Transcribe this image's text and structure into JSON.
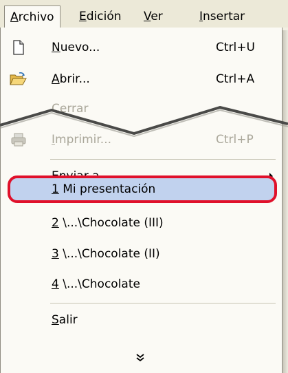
{
  "menubar": {
    "items": [
      {
        "label": "Archivo",
        "accel": "A",
        "rest": "rchivo"
      },
      {
        "label": "Edición",
        "accel": "E",
        "rest": "dición"
      },
      {
        "label": "Ver",
        "accel": "V",
        "rest": "er"
      },
      {
        "label": "Insertar",
        "accel": "I",
        "rest": "nsertar"
      }
    ]
  },
  "menu": {
    "nuevo": {
      "label": "Nuevo...",
      "accel": "N",
      "rest": "uevo...",
      "shortcut": "Ctrl+U"
    },
    "abrir": {
      "label": "Abrir...",
      "accel": "A",
      "rest": "brir...",
      "shortcut": "Ctrl+A"
    },
    "cerrar": {
      "label": "Cerrar",
      "pre": "C",
      "accel": "e",
      "rest": "rrar"
    },
    "imprimir": {
      "label": "Imprimir...",
      "accel": "I",
      "rest": "mprimir...",
      "shortcut": "Ctrl+P"
    },
    "enviar": {
      "label": "Enviar a",
      "pre": "En",
      "accel": "v",
      "rest": "iar a"
    },
    "recent": [
      {
        "label": "1 Mi presentación",
        "accel": "1",
        "rest": " Mi presentación"
      },
      {
        "label": "2 \\...\\Chocolate (III)",
        "accel": "2",
        "rest": " \\...\\Chocolate (III)"
      },
      {
        "label": "3 \\...\\Chocolate (II)",
        "accel": "3",
        "rest": " \\...\\Chocolate (II)"
      },
      {
        "label": "4 \\...\\Chocolate",
        "accel": "4",
        "rest": " \\...\\Chocolate"
      }
    ],
    "salir": {
      "label": "Salir",
      "accel": "S",
      "rest": "alir"
    }
  },
  "colors": {
    "highlight_fill": "#c1d2ee",
    "highlight_border": "#e0102a",
    "menu_background": "#fbfaf5",
    "disabled_text": "#aaa79a"
  },
  "icons": [
    "new-document-icon",
    "open-folder-icon",
    "print-icon",
    "submenu-arrow-icon",
    "expand-chevron-icon"
  ]
}
